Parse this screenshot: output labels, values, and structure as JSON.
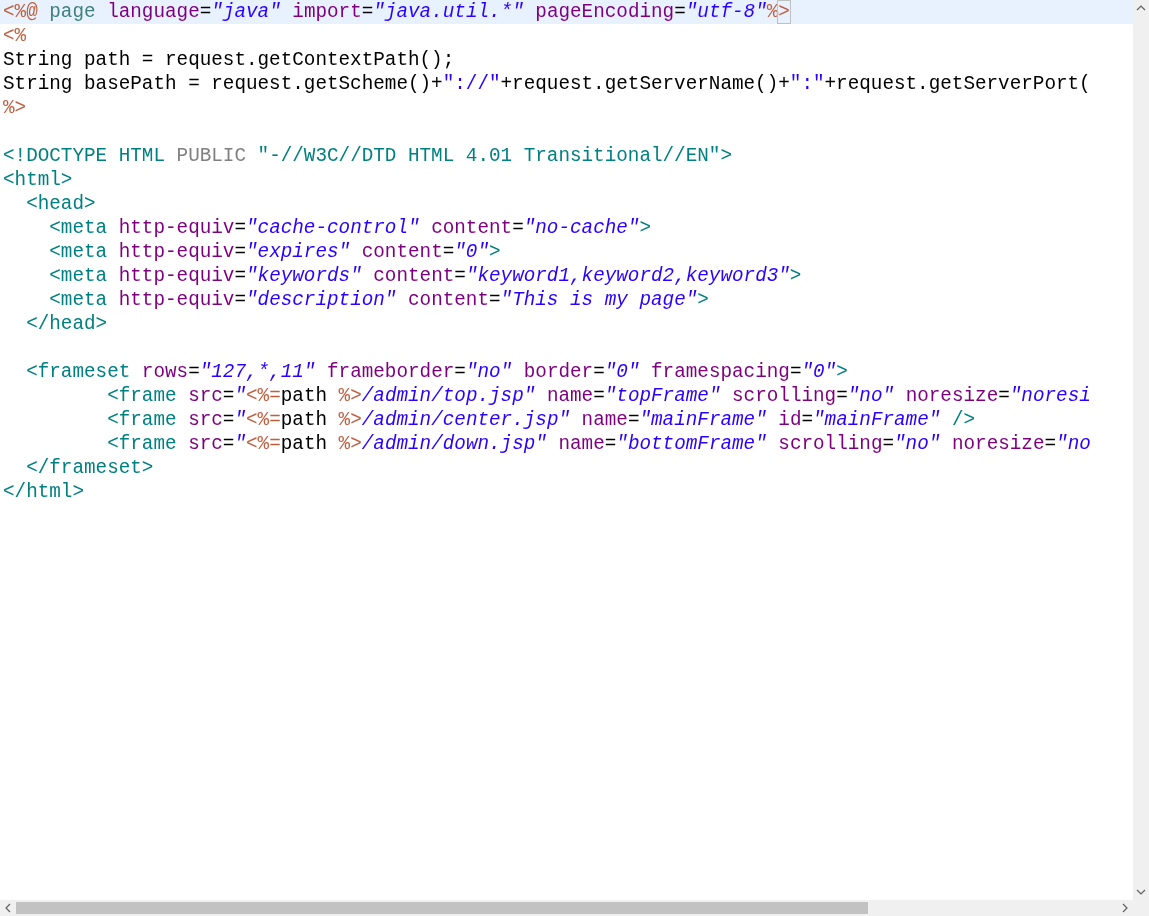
{
  "editor": {
    "lines": [
      {
        "current": true,
        "tokens": [
          {
            "kind": "jsp",
            "text": "<%@"
          },
          {
            "kind": "directive",
            "text": " page "
          },
          {
            "kind": "attr",
            "text": "language"
          },
          {
            "kind": "plain",
            "text": "="
          },
          {
            "kind": "str",
            "text": "\"java\""
          },
          {
            "kind": "attr",
            "text": " import"
          },
          {
            "kind": "plain",
            "text": "="
          },
          {
            "kind": "str",
            "text": "\"java.util.*\""
          },
          {
            "kind": "attr",
            "text": " pageEncoding"
          },
          {
            "kind": "plain",
            "text": "="
          },
          {
            "kind": "str",
            "text": "\"utf-8\""
          },
          {
            "kind": "jsp",
            "text": "%"
          },
          {
            "kind": "match",
            "text": ">"
          }
        ]
      },
      {
        "current": false,
        "tokens": [
          {
            "kind": "jsp",
            "text": "<%"
          }
        ]
      },
      {
        "current": false,
        "tokens": [
          {
            "kind": "plain",
            "text": "String path = request.getContextPath();"
          }
        ]
      },
      {
        "current": false,
        "tokens": [
          {
            "kind": "plain",
            "text": "String basePath = request.getScheme()+"
          },
          {
            "kind": "literal",
            "text": "\"://\""
          },
          {
            "kind": "plain",
            "text": "+request.getServerName()+"
          },
          {
            "kind": "literal",
            "text": "\":\""
          },
          {
            "kind": "plain",
            "text": "+request.getServerPort("
          }
        ]
      },
      {
        "current": false,
        "tokens": [
          {
            "kind": "jsp",
            "text": "%>"
          }
        ]
      },
      {
        "current": false
      },
      {
        "current": false,
        "tokens": [
          {
            "kind": "tag",
            "text": "<!DOCTYPE HTML "
          },
          {
            "kind": "keyword",
            "text": "PUBLIC "
          },
          {
            "kind": "tag",
            "text": "\"-//W3C//DTD HTML 4.01 Transitional//EN\">"
          }
        ]
      },
      {
        "current": false,
        "tokens": [
          {
            "kind": "tag",
            "text": "<html>"
          }
        ]
      },
      {
        "current": false,
        "tokens": [
          {
            "kind": "tag",
            "text": "  <head>"
          }
        ]
      },
      {
        "current": false,
        "tokens": [
          {
            "kind": "tag",
            "text": "    <meta"
          },
          {
            "kind": "attr",
            "text": " http-equiv"
          },
          {
            "kind": "plain",
            "text": "="
          },
          {
            "kind": "str",
            "text": "\"cache-control\""
          },
          {
            "kind": "attr",
            "text": " content"
          },
          {
            "kind": "plain",
            "text": "="
          },
          {
            "kind": "str",
            "text": "\"no-cache\""
          },
          {
            "kind": "tag",
            "text": ">"
          }
        ]
      },
      {
        "current": false,
        "tokens": [
          {
            "kind": "tag",
            "text": "    <meta"
          },
          {
            "kind": "attr",
            "text": " http-equiv"
          },
          {
            "kind": "plain",
            "text": "="
          },
          {
            "kind": "str",
            "text": "\"expires\""
          },
          {
            "kind": "attr",
            "text": " content"
          },
          {
            "kind": "plain",
            "text": "="
          },
          {
            "kind": "str",
            "text": "\"0\""
          },
          {
            "kind": "tag",
            "text": ">"
          }
        ]
      },
      {
        "current": false,
        "tokens": [
          {
            "kind": "tag",
            "text": "    <meta"
          },
          {
            "kind": "attr",
            "text": " http-equiv"
          },
          {
            "kind": "plain",
            "text": "="
          },
          {
            "kind": "str",
            "text": "\"keywords\""
          },
          {
            "kind": "attr",
            "text": " content"
          },
          {
            "kind": "plain",
            "text": "="
          },
          {
            "kind": "str",
            "text": "\"keyword1,keyword2,keyword3\""
          },
          {
            "kind": "tag",
            "text": ">"
          }
        ]
      },
      {
        "current": false,
        "tokens": [
          {
            "kind": "tag",
            "text": "    <meta"
          },
          {
            "kind": "attr",
            "text": " http-equiv"
          },
          {
            "kind": "plain",
            "text": "="
          },
          {
            "kind": "str",
            "text": "\"description\""
          },
          {
            "kind": "attr",
            "text": " content"
          },
          {
            "kind": "plain",
            "text": "="
          },
          {
            "kind": "str",
            "text": "\"This is my page\""
          },
          {
            "kind": "tag",
            "text": ">"
          }
        ]
      },
      {
        "current": false,
        "tokens": [
          {
            "kind": "tag",
            "text": "  </head>"
          }
        ]
      },
      {
        "current": false
      },
      {
        "current": false,
        "tokens": [
          {
            "kind": "tag",
            "text": "  <frameset"
          },
          {
            "kind": "attr",
            "text": " rows"
          },
          {
            "kind": "plain",
            "text": "="
          },
          {
            "kind": "str",
            "text": "\"127,*,11\""
          },
          {
            "kind": "attr",
            "text": " frameborder"
          },
          {
            "kind": "plain",
            "text": "="
          },
          {
            "kind": "str",
            "text": "\"no\""
          },
          {
            "kind": "attr",
            "text": " border"
          },
          {
            "kind": "plain",
            "text": "="
          },
          {
            "kind": "str",
            "text": "\"0\""
          },
          {
            "kind": "attr",
            "text": " framespacing"
          },
          {
            "kind": "plain",
            "text": "="
          },
          {
            "kind": "str",
            "text": "\"0\""
          },
          {
            "kind": "tag",
            "text": ">"
          }
        ]
      },
      {
        "current": false,
        "tokens": [
          {
            "kind": "tag",
            "text": "         <frame"
          },
          {
            "kind": "attr",
            "text": " src"
          },
          {
            "kind": "plain",
            "text": "="
          },
          {
            "kind": "str",
            "text": "\""
          },
          {
            "kind": "jsp",
            "text": "<%="
          },
          {
            "kind": "plain",
            "text": "path "
          },
          {
            "kind": "jsp",
            "text": "%>"
          },
          {
            "kind": "str",
            "text": "/admin/top.jsp\""
          },
          {
            "kind": "attr",
            "text": " name"
          },
          {
            "kind": "plain",
            "text": "="
          },
          {
            "kind": "str",
            "text": "\"topFrame\""
          },
          {
            "kind": "attr",
            "text": " scrolling"
          },
          {
            "kind": "plain",
            "text": "="
          },
          {
            "kind": "str",
            "text": "\"no\""
          },
          {
            "kind": "attr",
            "text": " noresize"
          },
          {
            "kind": "plain",
            "text": "="
          },
          {
            "kind": "str",
            "text": "\"noresi"
          }
        ]
      },
      {
        "current": false,
        "tokens": [
          {
            "kind": "tag",
            "text": "         <frame"
          },
          {
            "kind": "attr",
            "text": " src"
          },
          {
            "kind": "plain",
            "text": "="
          },
          {
            "kind": "str",
            "text": "\""
          },
          {
            "kind": "jsp",
            "text": "<%="
          },
          {
            "kind": "plain",
            "text": "path "
          },
          {
            "kind": "jsp",
            "text": "%>"
          },
          {
            "kind": "str",
            "text": "/admin/center.jsp\""
          },
          {
            "kind": "attr",
            "text": " name"
          },
          {
            "kind": "plain",
            "text": "="
          },
          {
            "kind": "str",
            "text": "\"mainFrame\""
          },
          {
            "kind": "attr",
            "text": " id"
          },
          {
            "kind": "plain",
            "text": "="
          },
          {
            "kind": "str",
            "text": "\"mainFrame\""
          },
          {
            "kind": "tag",
            "text": " />"
          }
        ]
      },
      {
        "current": false,
        "tokens": [
          {
            "kind": "tag",
            "text": "         <frame"
          },
          {
            "kind": "attr",
            "text": " src"
          },
          {
            "kind": "plain",
            "text": "="
          },
          {
            "kind": "str",
            "text": "\""
          },
          {
            "kind": "jsp",
            "text": "<%="
          },
          {
            "kind": "plain",
            "text": "path "
          },
          {
            "kind": "jsp",
            "text": "%>"
          },
          {
            "kind": "str",
            "text": "/admin/down.jsp\""
          },
          {
            "kind": "attr",
            "text": " name"
          },
          {
            "kind": "plain",
            "text": "="
          },
          {
            "kind": "str",
            "text": "\"bottomFrame\""
          },
          {
            "kind": "attr",
            "text": " scrolling"
          },
          {
            "kind": "plain",
            "text": "="
          },
          {
            "kind": "str",
            "text": "\"no\""
          },
          {
            "kind": "attr",
            "text": " noresize"
          },
          {
            "kind": "plain",
            "text": "="
          },
          {
            "kind": "str",
            "text": "\"no"
          }
        ]
      },
      {
        "current": false,
        "tokens": [
          {
            "kind": "tag",
            "text": "  </frameset>"
          }
        ]
      },
      {
        "current": false,
        "tokens": [
          {
            "kind": "tag",
            "text": "</html>"
          }
        ]
      }
    ]
  }
}
